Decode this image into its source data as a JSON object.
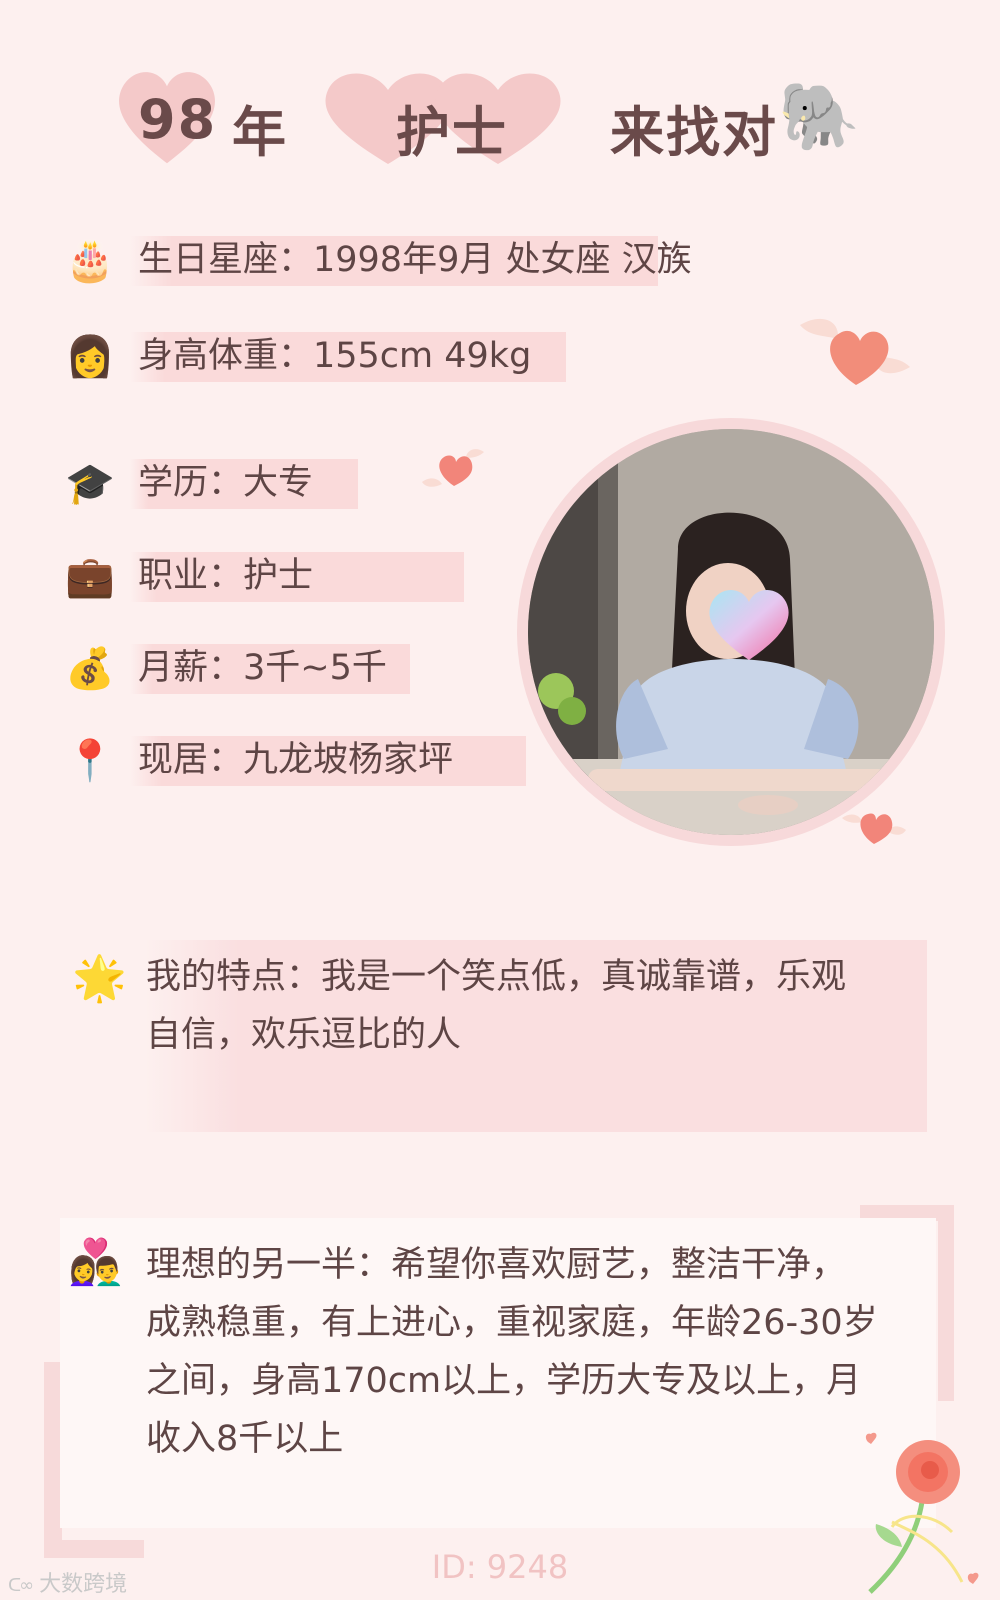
{
  "title": {
    "year": "98",
    "year_suffix": "年",
    "job": "护士",
    "seeking": "来找对",
    "seeking_emoji": "🐘"
  },
  "info": [
    {
      "icon": "birthday-cake-icon",
      "emoji": "🎂",
      "text": "生日星座：1998年9月 处女座 汉族"
    },
    {
      "icon": "woman-icon",
      "emoji": "👩",
      "text": "身高体重：155cm 49kg"
    },
    {
      "icon": "graduation-cap-icon",
      "emoji": "🎓",
      "text": "学历：大专"
    },
    {
      "icon": "briefcase-icon",
      "emoji": "💼",
      "text": "职业：护士"
    },
    {
      "icon": "money-bag-icon",
      "emoji": "💰",
      "text": "月薪：3千~5千"
    },
    {
      "icon": "location-pin-icon",
      "emoji": "📍",
      "text": "现居：九龙坡杨家坪"
    }
  ],
  "feature": {
    "emoji": "🌟",
    "line1": "我的特点：我是一个笑点低，真诚靠谱，乐观",
    "line2": "自信，欢乐逗比的人"
  },
  "ideal": {
    "emoji": "👩‍❤️‍👨",
    "line1": "理想的另一半：希望你喜欢厨艺，整洁干净，",
    "line2": "成熟稳重，有上进心，重视家庭，年龄26-30岁",
    "line3": "之间，身高170cm以上，学历大专及以上，月",
    "line4": "收入8千以上"
  },
  "footer": {
    "id": "ID: 9248",
    "watermark": "大数跨境"
  },
  "colors": {
    "background": "#fdf0ef",
    "highlight": "#fadada",
    "heart": "#f4c9c9",
    "text": "#5e4545"
  }
}
